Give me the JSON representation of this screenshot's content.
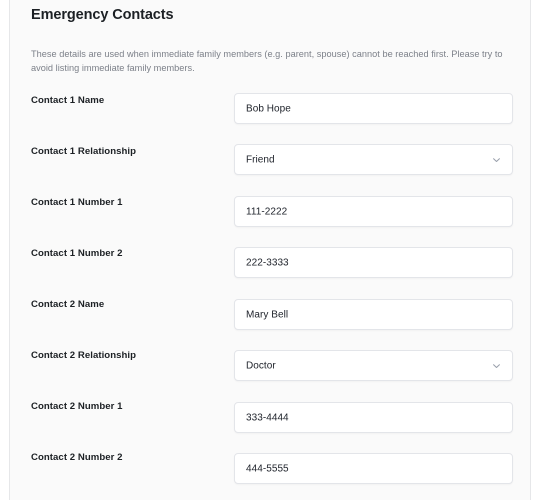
{
  "card": {
    "title": "Emergency Contacts",
    "description": "These details are used when immediate family members (e.g. parent, spouse) cannot be reached first. Please try to avoid listing immediate family members."
  },
  "theme": {
    "page_bg": "#ffffff",
    "card_bg": "#fafafa",
    "card_border": "#e6e7e9",
    "input_bg": "#ffffff",
    "input_border": "#e3e5e9",
    "label_color": "#1c2024",
    "value_color": "#20242c",
    "description_color": "#7c8089"
  },
  "fields": [
    {
      "label": "Contact 1 Name",
      "type": "text",
      "value": "Bob Hope",
      "name": "contact-1-name"
    },
    {
      "label": "Contact 1 Relationship",
      "type": "select",
      "value": "Friend",
      "icon": "chevron-down-icon",
      "name": "contact-1-relationship"
    },
    {
      "label": "Contact 1 Number 1",
      "type": "text",
      "value": "111-2222",
      "name": "contact-1-number-1"
    },
    {
      "label": "Contact 1 Number 2",
      "type": "text",
      "value": "222-3333",
      "name": "contact-1-number-2"
    },
    {
      "label": "Contact 2 Name",
      "type": "text",
      "value": "Mary Bell",
      "name": "contact-2-name"
    },
    {
      "label": "Contact 2 Relationship",
      "type": "select",
      "value": "Doctor",
      "icon": "chevron-down-icon",
      "name": "contact-2-relationship"
    },
    {
      "label": "Contact 2 Number 1",
      "type": "text",
      "value": "333-4444",
      "name": "contact-2-number-1"
    },
    {
      "label": "Contact 2 Number 2",
      "type": "text",
      "value": "444-5555",
      "name": "contact-2-number-2"
    }
  ]
}
